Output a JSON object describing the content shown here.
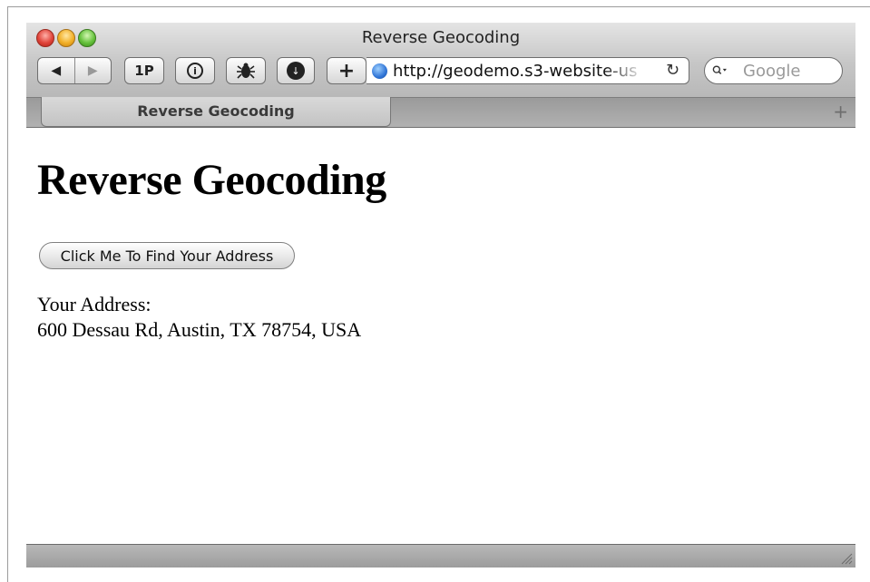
{
  "window": {
    "title": "Reverse Geocoding"
  },
  "toolbar": {
    "back_icon": "◀",
    "forward_icon": "▶",
    "onepassword_label": "1P",
    "info_label": "i",
    "download_icon": "↓",
    "add_bookmark_label": "+",
    "url": "http://geodemo.s3-website-us",
    "reload_icon": "↻",
    "search_placeholder": "Google"
  },
  "tabs": [
    {
      "label": "Reverse Geocoding",
      "active": true
    }
  ],
  "new_tab_label": "+",
  "page": {
    "heading": "Reverse Geocoding",
    "button_label": "Click Me To Find Your Address",
    "address_label": "Your Address:",
    "address_value": "600 Dessau Rd, Austin, TX 78754, USA"
  },
  "colors": {
    "close": "#e0443a",
    "minimize": "#f2b028",
    "zoom": "#66c23d",
    "chrome": "#c6c6c6"
  }
}
